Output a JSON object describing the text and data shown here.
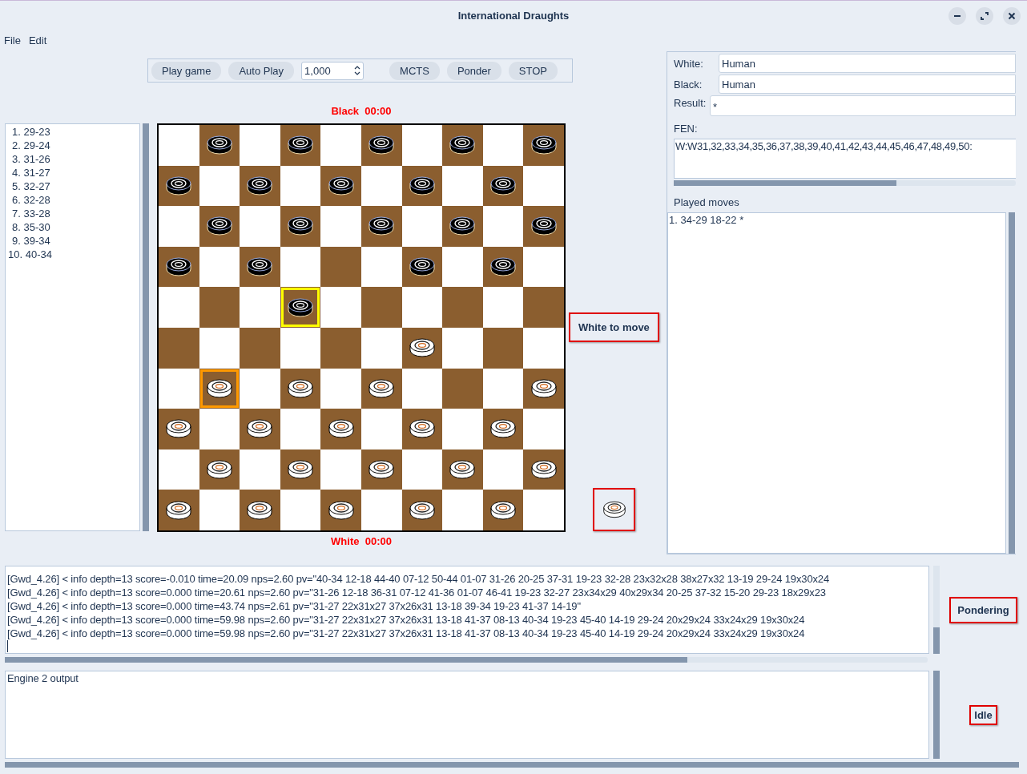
{
  "window": {
    "title": "International Draughts"
  },
  "menu": [
    "File",
    "Edit"
  ],
  "toolbar": {
    "buttons_left": [
      "Play game",
      "Auto Play"
    ],
    "spinner": {
      "value": "1,000"
    },
    "buttons_right": [
      "MCTS",
      "Ponder",
      "STOP"
    ]
  },
  "clocks": [
    {
      "label": "Black",
      "time": "00:00"
    },
    {
      "label": "White",
      "time": "00:00"
    }
  ],
  "move_options": [
    "1. 29-23",
    "2. 29-24",
    "3. 31-26",
    "4. 31-27",
    "5. 32-27",
    "6. 32-28",
    "7. 33-28",
    "8. 35-30",
    "9. 39-34",
    "10. 40-34"
  ],
  "board": {
    "rows": [
      [
        {
          "kind": "empty"
        },
        {
          "kind": "black"
        },
        {
          "kind": "empty"
        },
        {
          "kind": "black"
        },
        {
          "kind": "empty"
        },
        {
          "kind": "black"
        },
        {
          "kind": "empty"
        },
        {
          "kind": "black"
        },
        {
          "kind": "empty"
        },
        {
          "kind": "black"
        }
      ],
      [
        {
          "kind": "black"
        },
        {
          "kind": "empty"
        },
        {
          "kind": "black"
        },
        {
          "kind": "empty"
        },
        {
          "kind": "black"
        },
        {
          "kind": "empty"
        },
        {
          "kind": "black"
        },
        {
          "kind": "empty"
        },
        {
          "kind": "black"
        },
        {
          "kind": "empty"
        }
      ],
      [
        {
          "kind": "empty"
        },
        {
          "kind": "black"
        },
        {
          "kind": "empty"
        },
        {
          "kind": "black"
        },
        {
          "kind": "empty"
        },
        {
          "kind": "black"
        },
        {
          "kind": "empty"
        },
        {
          "kind": "black"
        },
        {
          "kind": "empty"
        },
        {
          "kind": "black"
        }
      ],
      [
        {
          "kind": "black"
        },
        {
          "kind": "empty"
        },
        {
          "kind": "black"
        },
        {
          "kind": "empty"
        },
        {
          "kind": "empty"
        },
        {
          "kind": "empty"
        },
        {
          "kind": "black"
        },
        {
          "kind": "empty"
        },
        {
          "kind": "black"
        },
        {
          "kind": "empty"
        }
      ],
      [
        {
          "kind": "empty"
        },
        {
          "kind": "empty"
        },
        {
          "kind": "empty"
        },
        {
          "kind": "black",
          "color": "#ffff00"
        },
        {
          "kind": "empty"
        },
        {
          "kind": "empty"
        },
        {
          "kind": "empty"
        },
        {
          "kind": "empty"
        },
        {
          "kind": "empty"
        },
        {
          "kind": "empty"
        }
      ],
      [
        {
          "kind": "empty"
        },
        {
          "kind": "empty"
        },
        {
          "kind": "empty"
        },
        {
          "kind": "empty"
        },
        {
          "kind": "empty"
        },
        {
          "kind": "empty"
        },
        {
          "kind": "white"
        },
        {
          "kind": "empty"
        },
        {
          "kind": "empty"
        },
        {
          "kind": "empty"
        }
      ],
      [
        {
          "kind": "empty"
        },
        {
          "kind": "white",
          "color": "#ff9900"
        },
        {
          "kind": "empty"
        },
        {
          "kind": "white"
        },
        {
          "kind": "empty"
        },
        {
          "kind": "white"
        },
        {
          "kind": "empty"
        },
        {
          "kind": "empty"
        },
        {
          "kind": "empty"
        },
        {
          "kind": "white"
        }
      ],
      [
        {
          "kind": "white"
        },
        {
          "kind": "empty"
        },
        {
          "kind": "white"
        },
        {
          "kind": "empty"
        },
        {
          "kind": "white"
        },
        {
          "kind": "empty"
        },
        {
          "kind": "white"
        },
        {
          "kind": "empty"
        },
        {
          "kind": "white"
        },
        {
          "kind": "empty"
        }
      ],
      [
        {
          "kind": "empty"
        },
        {
          "kind": "white"
        },
        {
          "kind": "empty"
        },
        {
          "kind": "white"
        },
        {
          "kind": "empty"
        },
        {
          "kind": "white"
        },
        {
          "kind": "empty"
        },
        {
          "kind": "white"
        },
        {
          "kind": "empty"
        },
        {
          "kind": "white"
        }
      ],
      [
        {
          "kind": "white"
        },
        {
          "kind": "empty"
        },
        {
          "kind": "white"
        },
        {
          "kind": "empty"
        },
        {
          "kind": "white"
        },
        {
          "kind": "empty"
        },
        {
          "kind": "white"
        },
        {
          "kind": "empty"
        },
        {
          "kind": "white"
        },
        {
          "kind": "empty"
        }
      ]
    ]
  },
  "side_to_move": {
    "label": "White to move",
    "kind": "white"
  },
  "game_info": {
    "fields": [
      {
        "label": "White:",
        "value": "Human"
      },
      {
        "label": "Black:",
        "value": "Human"
      },
      {
        "label": "Result:",
        "value": "*"
      }
    ],
    "fen": {
      "label": "FEN:",
      "value": "W:W31,32,33,34,35,36,37,38,39,40,41,42,43,44,45,46,47,48,49,50:"
    }
  },
  "played_moves": {
    "label": "Played moves",
    "text": "1. 34-29 18-22 *"
  },
  "engines": [
    {
      "log": [
        "[Gwd_4.26] < info depth=13 score=-0.010 time=20.09 nps=2.60 pv=\"40-34 12-18 44-40 07-12 50-44 01-07 31-26 20-25 37-31 19-23 32-28 23x32x28 38x27x32 13-19 29-24 19x30x24",
        "[Gwd_4.26] < info depth=13 score=0.000 time=20.61 nps=2.60 pv=\"31-26 12-18 36-31 07-12 41-36 01-07 46-41 19-23 32-27 23x34x29 40x29x34 20-25 37-32 15-20 29-23 18x29x23",
        "[Gwd_4.26] < info depth=13 score=0.000 time=43.74 nps=2.61 pv=\"31-27 22x31x27 37x26x31 13-18 39-34 19-23 41-37 14-19\"",
        "[Gwd_4.26] < info depth=13 score=0.000 time=59.98 nps=2.60 pv=\"31-27 22x31x27 37x26x31 13-18 41-37 08-13 40-34 19-23 45-40 14-19 29-24 20x29x24 33x24x29 19x30x24",
        "[Gwd_4.26] < info depth=13 score=0.000 time=59.98 nps=2.60 pv=\"31-27 22x31x27 37x26x31 13-18 41-37 08-13 40-34 19-23 45-40 14-19 29-24 20x29x24 33x24x29 19x30x24"
      ],
      "status": "Pondering"
    },
    {
      "log": [
        "Engine 2 output"
      ],
      "status": "Idle"
    }
  ]
}
